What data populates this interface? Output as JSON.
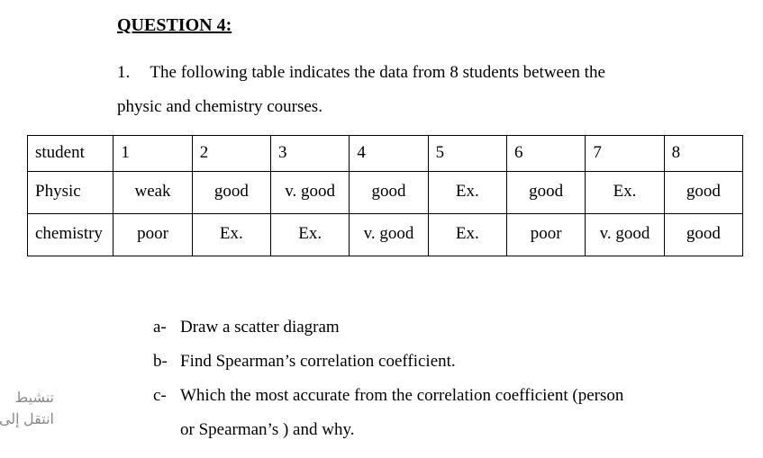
{
  "heading": "QUESTION 4:",
  "intro": {
    "number": "1.",
    "line1": "The following table indicates the data from 8 students between the",
    "line2": "physic and chemistry courses."
  },
  "table": {
    "header_label": "student",
    "row1_label": "Physic",
    "row2_label": "chemistry",
    "students": [
      "1",
      "2",
      "3",
      "4",
      "5",
      "6",
      "7",
      "8"
    ],
    "physic": [
      "weak",
      "good",
      "v. good",
      "good",
      "Ex.",
      "good",
      "Ex.",
      "good"
    ],
    "chemistry": [
      "poor",
      "Ex.",
      "Ex.",
      "v. good",
      "Ex.",
      "poor",
      "v. good",
      "good"
    ]
  },
  "tasks": {
    "a": {
      "letter": "a-",
      "text": "Draw a scatter diagram"
    },
    "b": {
      "letter": "b-",
      "text": "Find Spearman’s correlation coefficient."
    },
    "c": {
      "letter": "c-",
      "text1": "Which the most accurate from the correlation coefficient (person",
      "text2": "or Spearman’s ) and why."
    }
  },
  "watermark": {
    "line1": "تنشيط",
    "line2": "انتقل إلى"
  }
}
